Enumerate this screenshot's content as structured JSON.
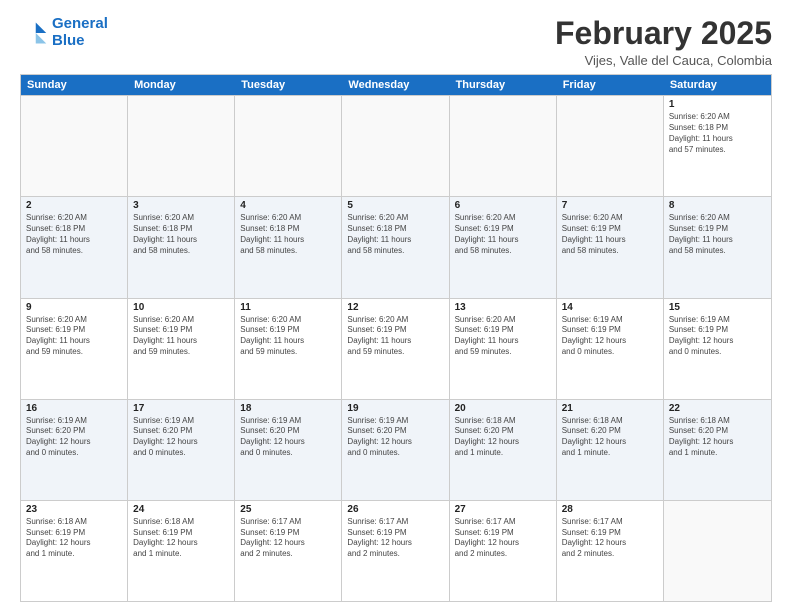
{
  "logo": {
    "line1": "General",
    "line2": "Blue"
  },
  "title": "February 2025",
  "location": "Vijes, Valle del Cauca, Colombia",
  "day_headers": [
    "Sunday",
    "Monday",
    "Tuesday",
    "Wednesday",
    "Thursday",
    "Friday",
    "Saturday"
  ],
  "weeks": [
    {
      "alt": false,
      "cells": [
        {
          "day": "",
          "info": ""
        },
        {
          "day": "",
          "info": ""
        },
        {
          "day": "",
          "info": ""
        },
        {
          "day": "",
          "info": ""
        },
        {
          "day": "",
          "info": ""
        },
        {
          "day": "",
          "info": ""
        },
        {
          "day": "1",
          "info": "Sunrise: 6:20 AM\nSunset: 6:18 PM\nDaylight: 11 hours\nand 57 minutes."
        }
      ]
    },
    {
      "alt": true,
      "cells": [
        {
          "day": "2",
          "info": "Sunrise: 6:20 AM\nSunset: 6:18 PM\nDaylight: 11 hours\nand 58 minutes."
        },
        {
          "day": "3",
          "info": "Sunrise: 6:20 AM\nSunset: 6:18 PM\nDaylight: 11 hours\nand 58 minutes."
        },
        {
          "day": "4",
          "info": "Sunrise: 6:20 AM\nSunset: 6:18 PM\nDaylight: 11 hours\nand 58 minutes."
        },
        {
          "day": "5",
          "info": "Sunrise: 6:20 AM\nSunset: 6:18 PM\nDaylight: 11 hours\nand 58 minutes."
        },
        {
          "day": "6",
          "info": "Sunrise: 6:20 AM\nSunset: 6:19 PM\nDaylight: 11 hours\nand 58 minutes."
        },
        {
          "day": "7",
          "info": "Sunrise: 6:20 AM\nSunset: 6:19 PM\nDaylight: 11 hours\nand 58 minutes."
        },
        {
          "day": "8",
          "info": "Sunrise: 6:20 AM\nSunset: 6:19 PM\nDaylight: 11 hours\nand 58 minutes."
        }
      ]
    },
    {
      "alt": false,
      "cells": [
        {
          "day": "9",
          "info": "Sunrise: 6:20 AM\nSunset: 6:19 PM\nDaylight: 11 hours\nand 59 minutes."
        },
        {
          "day": "10",
          "info": "Sunrise: 6:20 AM\nSunset: 6:19 PM\nDaylight: 11 hours\nand 59 minutes."
        },
        {
          "day": "11",
          "info": "Sunrise: 6:20 AM\nSunset: 6:19 PM\nDaylight: 11 hours\nand 59 minutes."
        },
        {
          "day": "12",
          "info": "Sunrise: 6:20 AM\nSunset: 6:19 PM\nDaylight: 11 hours\nand 59 minutes."
        },
        {
          "day": "13",
          "info": "Sunrise: 6:20 AM\nSunset: 6:19 PM\nDaylight: 11 hours\nand 59 minutes."
        },
        {
          "day": "14",
          "info": "Sunrise: 6:19 AM\nSunset: 6:19 PM\nDaylight: 12 hours\nand 0 minutes."
        },
        {
          "day": "15",
          "info": "Sunrise: 6:19 AM\nSunset: 6:19 PM\nDaylight: 12 hours\nand 0 minutes."
        }
      ]
    },
    {
      "alt": true,
      "cells": [
        {
          "day": "16",
          "info": "Sunrise: 6:19 AM\nSunset: 6:20 PM\nDaylight: 12 hours\nand 0 minutes."
        },
        {
          "day": "17",
          "info": "Sunrise: 6:19 AM\nSunset: 6:20 PM\nDaylight: 12 hours\nand 0 minutes."
        },
        {
          "day": "18",
          "info": "Sunrise: 6:19 AM\nSunset: 6:20 PM\nDaylight: 12 hours\nand 0 minutes."
        },
        {
          "day": "19",
          "info": "Sunrise: 6:19 AM\nSunset: 6:20 PM\nDaylight: 12 hours\nand 0 minutes."
        },
        {
          "day": "20",
          "info": "Sunrise: 6:18 AM\nSunset: 6:20 PM\nDaylight: 12 hours\nand 1 minute."
        },
        {
          "day": "21",
          "info": "Sunrise: 6:18 AM\nSunset: 6:20 PM\nDaylight: 12 hours\nand 1 minute."
        },
        {
          "day": "22",
          "info": "Sunrise: 6:18 AM\nSunset: 6:20 PM\nDaylight: 12 hours\nand 1 minute."
        }
      ]
    },
    {
      "alt": false,
      "cells": [
        {
          "day": "23",
          "info": "Sunrise: 6:18 AM\nSunset: 6:19 PM\nDaylight: 12 hours\nand 1 minute."
        },
        {
          "day": "24",
          "info": "Sunrise: 6:18 AM\nSunset: 6:19 PM\nDaylight: 12 hours\nand 1 minute."
        },
        {
          "day": "25",
          "info": "Sunrise: 6:17 AM\nSunset: 6:19 PM\nDaylight: 12 hours\nand 2 minutes."
        },
        {
          "day": "26",
          "info": "Sunrise: 6:17 AM\nSunset: 6:19 PM\nDaylight: 12 hours\nand 2 minutes."
        },
        {
          "day": "27",
          "info": "Sunrise: 6:17 AM\nSunset: 6:19 PM\nDaylight: 12 hours\nand 2 minutes."
        },
        {
          "day": "28",
          "info": "Sunrise: 6:17 AM\nSunset: 6:19 PM\nDaylight: 12 hours\nand 2 minutes."
        },
        {
          "day": "",
          "info": ""
        }
      ]
    }
  ]
}
